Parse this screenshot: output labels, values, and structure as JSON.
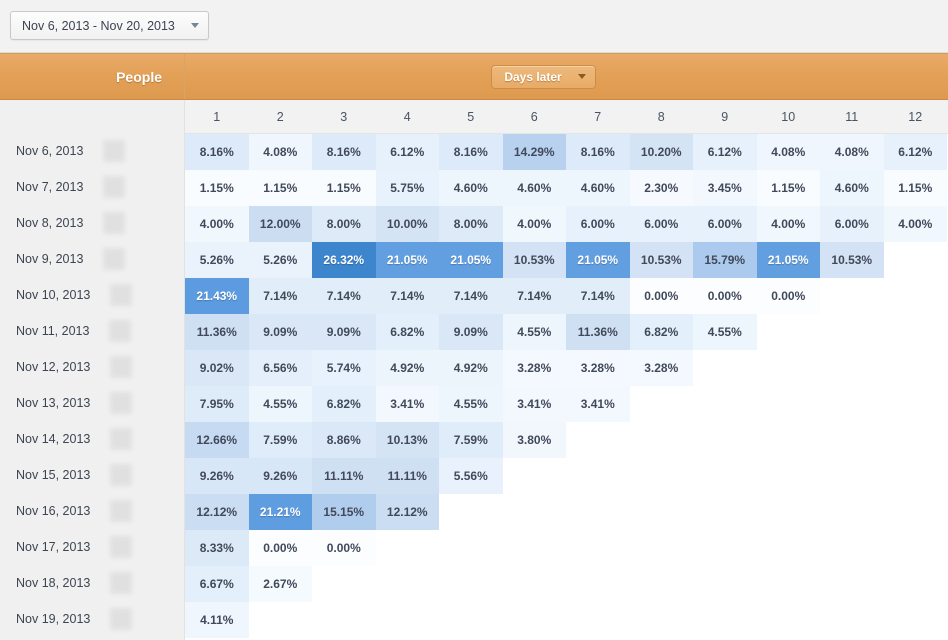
{
  "toolbar": {
    "date_range_label": "Nov 6, 2013 - Nov 20, 2013",
    "caret_icon": "chevron-down-icon"
  },
  "header": {
    "people_label": "People",
    "days_later_label": "Days later",
    "days_later_caret_icon": "chevron-down-icon",
    "orange_color": "#e3a057"
  },
  "colors": {
    "accent_orange": "#e3a057",
    "heat_max": "#3d85cc",
    "heat_mid": "#5a9ae0",
    "heat_min": "#f7fafe",
    "text": "#41495a"
  },
  "chart_data": {
    "type": "heatmap",
    "title": "Cohort retention by days later",
    "xlabel": "Days later",
    "ylabel": "People",
    "columns": [
      "1",
      "2",
      "3",
      "4",
      "5",
      "6",
      "7",
      "8",
      "9",
      "10",
      "11",
      "12"
    ],
    "row_label_header": "People",
    "value_suffix": "%",
    "vmin": 0,
    "vmax": 26.32,
    "rows": [
      {
        "label": "Nov 6, 2013",
        "values": [
          8.16,
          4.08,
          8.16,
          6.12,
          8.16,
          14.29,
          8.16,
          10.2,
          6.12,
          4.08,
          4.08,
          6.12
        ],
        "display": [
          "8.16%",
          "4.08%",
          "8.16%",
          "6.12%",
          "8.16%",
          "14.29%",
          "8.16%",
          "10.20%",
          "6.12%",
          "4.08%",
          "4.08%",
          "6.12%"
        ]
      },
      {
        "label": "Nov 7, 2013",
        "values": [
          1.15,
          1.15,
          1.15,
          5.75,
          4.6,
          4.6,
          4.6,
          2.3,
          3.45,
          1.15,
          4.6,
          1.15
        ],
        "display": [
          "1.15%",
          "1.15%",
          "1.15%",
          "5.75%",
          "4.60%",
          "4.60%",
          "4.60%",
          "2.30%",
          "3.45%",
          "1.15%",
          "4.60%",
          "1.15%"
        ]
      },
      {
        "label": "Nov 8, 2013",
        "values": [
          4.0,
          12.0,
          8.0,
          10.0,
          8.0,
          4.0,
          6.0,
          6.0,
          6.0,
          4.0,
          6.0,
          4.0
        ],
        "display": [
          "4.00%",
          "12.00%",
          "8.00%",
          "10.00%",
          "8.00%",
          "4.00%",
          "6.00%",
          "6.00%",
          "6.00%",
          "4.00%",
          "6.00%",
          "4.00%"
        ]
      },
      {
        "label": "Nov 9, 2013",
        "values": [
          5.26,
          5.26,
          26.32,
          21.05,
          21.05,
          10.53,
          21.05,
          10.53,
          15.79,
          21.05,
          10.53,
          null
        ],
        "display": [
          "5.26%",
          "5.26%",
          "26.32%",
          "21.05%",
          "21.05%",
          "10.53%",
          "21.05%",
          "10.53%",
          "15.79%",
          "21.05%",
          "10.53%",
          ""
        ]
      },
      {
        "label": "Nov 10, 2013",
        "values": [
          21.43,
          7.14,
          7.14,
          7.14,
          7.14,
          7.14,
          7.14,
          0.0,
          0.0,
          0.0,
          null,
          null
        ],
        "display": [
          "21.43%",
          "7.14%",
          "7.14%",
          "7.14%",
          "7.14%",
          "7.14%",
          "7.14%",
          "0.00%",
          "0.00%",
          "0.00%",
          "",
          ""
        ]
      },
      {
        "label": "Nov 11, 2013",
        "values": [
          11.36,
          9.09,
          9.09,
          6.82,
          9.09,
          4.55,
          11.36,
          6.82,
          4.55,
          null,
          null,
          null
        ],
        "display": [
          "11.36%",
          "9.09%",
          "9.09%",
          "6.82%",
          "9.09%",
          "4.55%",
          "11.36%",
          "6.82%",
          "4.55%",
          "",
          "",
          ""
        ]
      },
      {
        "label": "Nov 12, 2013",
        "values": [
          9.02,
          6.56,
          5.74,
          4.92,
          4.92,
          3.28,
          3.28,
          3.28,
          null,
          null,
          null,
          null
        ],
        "display": [
          "9.02%",
          "6.56%",
          "5.74%",
          "4.92%",
          "4.92%",
          "3.28%",
          "3.28%",
          "3.28%",
          "",
          "",
          "",
          ""
        ]
      },
      {
        "label": "Nov 13, 2013",
        "values": [
          7.95,
          4.55,
          6.82,
          3.41,
          4.55,
          3.41,
          3.41,
          null,
          null,
          null,
          null,
          null
        ],
        "display": [
          "7.95%",
          "4.55%",
          "6.82%",
          "3.41%",
          "4.55%",
          "3.41%",
          "3.41%",
          "",
          "",
          "",
          "",
          ""
        ]
      },
      {
        "label": "Nov 14, 2013",
        "values": [
          12.66,
          7.59,
          8.86,
          10.13,
          7.59,
          3.8,
          null,
          null,
          null,
          null,
          null,
          null
        ],
        "display": [
          "12.66%",
          "7.59%",
          "8.86%",
          "10.13%",
          "7.59%",
          "3.80%",
          "",
          "",
          "",
          "",
          "",
          ""
        ]
      },
      {
        "label": "Nov 15, 2013",
        "values": [
          9.26,
          9.26,
          11.11,
          11.11,
          5.56,
          null,
          null,
          null,
          null,
          null,
          null,
          null
        ],
        "display": [
          "9.26%",
          "9.26%",
          "11.11%",
          "11.11%",
          "5.56%",
          "",
          "",
          "",
          "",
          "",
          "",
          ""
        ]
      },
      {
        "label": "Nov 16, 2013",
        "values": [
          12.12,
          21.21,
          15.15,
          12.12,
          null,
          null,
          null,
          null,
          null,
          null,
          null,
          null
        ],
        "display": [
          "12.12%",
          "21.21%",
          "15.15%",
          "12.12%",
          "",
          "",
          "",
          "",
          "",
          "",
          "",
          ""
        ]
      },
      {
        "label": "Nov 17, 2013",
        "values": [
          8.33,
          0.0,
          0.0,
          null,
          null,
          null,
          null,
          null,
          null,
          null,
          null,
          null
        ],
        "display": [
          "8.33%",
          "0.00%",
          "0.00%",
          "",
          "",
          "",
          "",
          "",
          "",
          "",
          "",
          ""
        ]
      },
      {
        "label": "Nov 18, 2013",
        "values": [
          6.67,
          2.67,
          null,
          null,
          null,
          null,
          null,
          null,
          null,
          null,
          null,
          null
        ],
        "display": [
          "6.67%",
          "2.67%",
          "",
          "",
          "",
          "",
          "",
          "",
          "",
          "",
          "",
          ""
        ]
      },
      {
        "label": "Nov 19, 2013",
        "values": [
          4.11,
          null,
          null,
          null,
          null,
          null,
          null,
          null,
          null,
          null,
          null,
          null
        ],
        "display": [
          "4.11%",
          "",
          "",
          "",
          "",
          "",
          "",
          "",
          "",
          "",
          "",
          ""
        ]
      }
    ]
  }
}
